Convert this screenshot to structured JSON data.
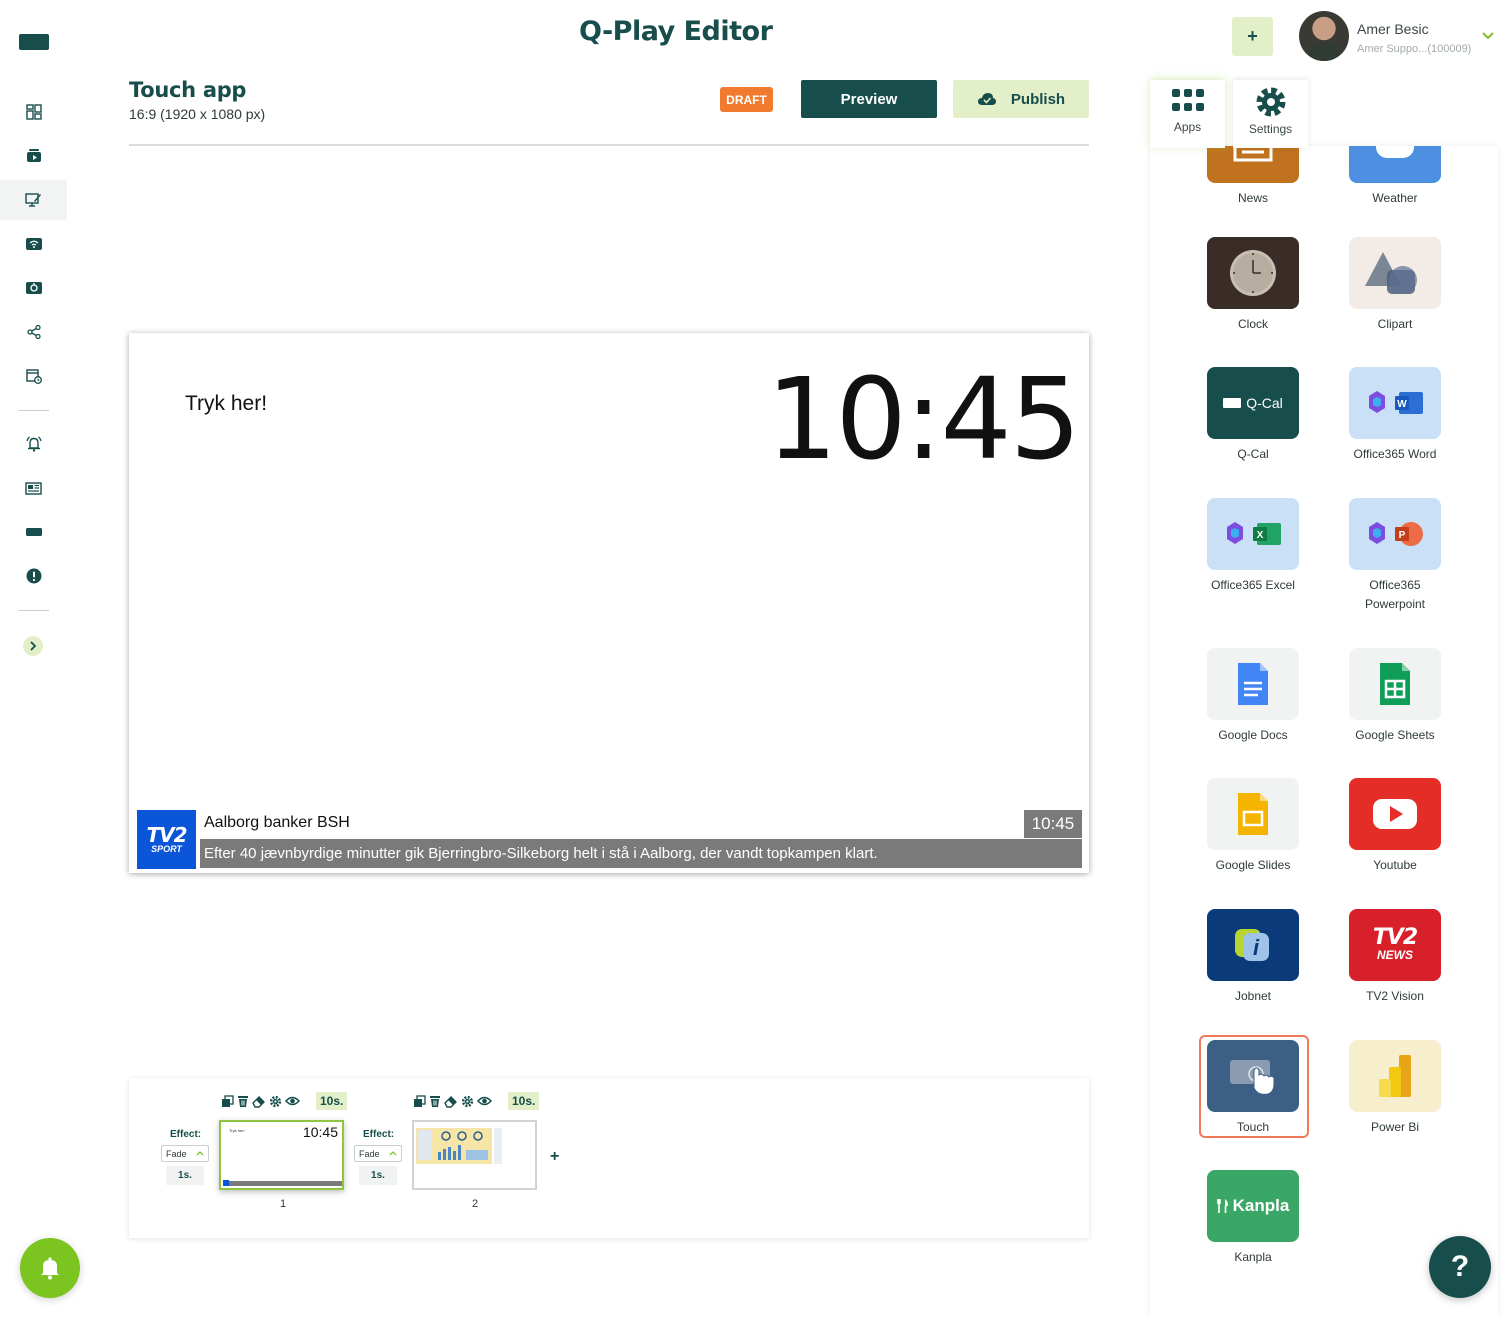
{
  "header": {
    "title": "Q-Play Editor",
    "add_label": "+",
    "user_name": "Amer Besic",
    "user_account": "Amer Suppo...(100009)"
  },
  "editor": {
    "title": "Touch app",
    "resolution": "16:9 (1920 x 1080 px)",
    "status_badge": "DRAFT",
    "preview_label": "Preview",
    "publish_label": "Publish"
  },
  "canvas": {
    "touch_text": "Tryk her!",
    "clock_time": "10:45",
    "ticker": {
      "logo_top": "TV2",
      "logo_bottom": "SPORT",
      "headline": "Aalborg banker BSH",
      "time": "10:45",
      "body": "Efter 40 jævnbyrdige minutter gik Bjerringbro-Silkeborg helt i stå i Aalborg, der vandt topkampen klart."
    }
  },
  "timeline": {
    "add_label": "+",
    "slides": [
      {
        "number": "1",
        "duration": "10s.",
        "effect_label": "Effect:",
        "effect": "Fade",
        "effect_duration": "1s.",
        "thumb_time": "10:45",
        "thumb_text": "Tryk her!"
      },
      {
        "number": "2",
        "duration": "10s.",
        "effect_label": "Effect:",
        "effect": "Fade",
        "effect_duration": "1s."
      }
    ]
  },
  "panel": {
    "tabs": [
      {
        "label": "Apps",
        "icon": "apps-grid-icon"
      },
      {
        "label": "Settings",
        "icon": "gear-icon"
      }
    ],
    "apps": [
      {
        "label": "News",
        "color": "#c0721e"
      },
      {
        "label": "Weather",
        "color": "#4d8fe0"
      },
      {
        "label": "Clock",
        "color": "#3a2d27"
      },
      {
        "label": "Clipart",
        "color": "#f3ebe6"
      },
      {
        "label": "Q-Cal",
        "icon_text": "Q-Cal",
        "color": "#174e4b"
      },
      {
        "label": "Office365 Word",
        "color": "#c9e0f7"
      },
      {
        "label": "Office365 Excel",
        "color": "#c9e0f7"
      },
      {
        "label_line1": "Office365",
        "label_line2": "Powerpoint",
        "color": "#c9e0f7"
      },
      {
        "label": "Google Docs",
        "color": "#f1f3f3"
      },
      {
        "label": "Google Sheets",
        "color": "#f1f3f3"
      },
      {
        "label": "Google Slides",
        "color": "#f1f3f3"
      },
      {
        "label": "Youtube",
        "color": "#e52d27"
      },
      {
        "label": "Jobnet",
        "color": "#0a3a7a"
      },
      {
        "label": "TV2 Vision",
        "icon_top": "TV2",
        "icon_bottom": "NEWS",
        "color": "#d8202a"
      },
      {
        "label": "Touch",
        "color": "#3c5f85"
      },
      {
        "label": "Power Bi",
        "color": "#f7eecd"
      },
      {
        "label": "Kanpla",
        "icon_text": "Kanpla",
        "color": "#3aa766"
      }
    ]
  },
  "help_label": "?",
  "colors": {
    "brand": "#174e4b",
    "accent_green": "#7cc520",
    "accent_light": "#e2efc8",
    "draft": "#f07a2d",
    "selection": "#f07a5a"
  }
}
